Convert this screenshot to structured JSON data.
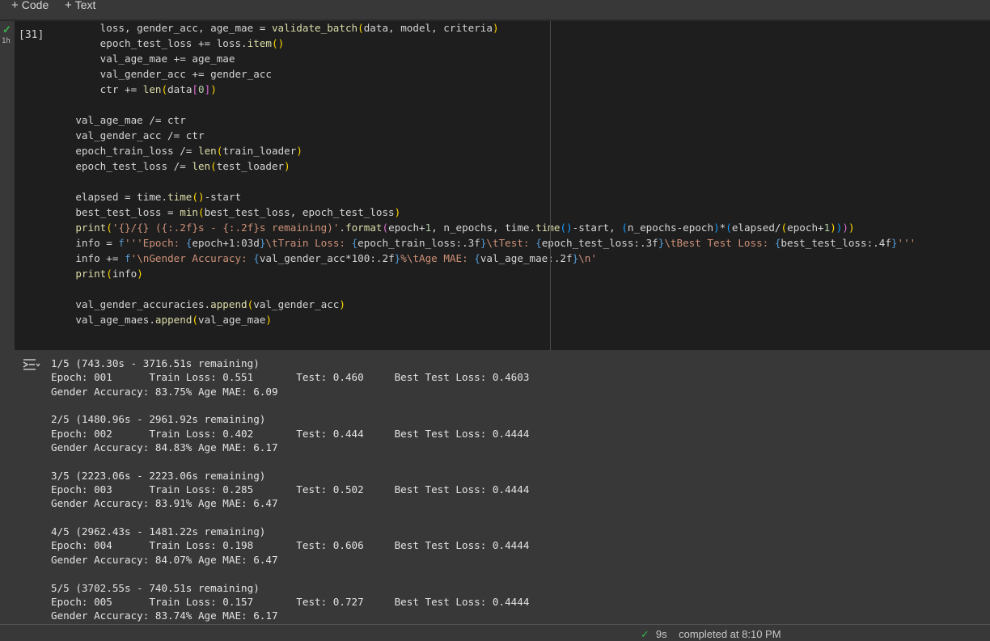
{
  "toolbar": {
    "code_label": "Code",
    "text_label": "Text"
  },
  "cell": {
    "exec_count": "[31]",
    "status_check": "✓",
    "exec_time": "1h"
  },
  "code_lines": [
    "        loss, gender_acc, age_mae = validate_batch(data, model, criteria)",
    "        epoch_test_loss += loss.item()",
    "        val_age_mae += age_mae",
    "        val_gender_acc += gender_acc",
    "        ctr += len(data[0])",
    "",
    "    val_age_mae /= ctr",
    "    val_gender_acc /= ctr",
    "    epoch_train_loss /= len(train_loader)",
    "    epoch_test_loss /= len(test_loader)",
    "",
    "    elapsed = time.time()-start",
    "    best_test_loss = min(best_test_loss, epoch_test_loss)",
    "    print('{}/{} ({:.2f}s - {:.2f}s remaining)'.format(epoch+1, n_epochs, time.time()-start, (n_epochs-epoch)*(elapsed/(epoch+1))))",
    "    info = f'''Epoch: {epoch+1:03d}\\tTrain Loss: {epoch_train_loss:.3f}\\tTest: {epoch_test_loss:.3f}\\tBest Test Loss: {best_test_loss:.4f}'''",
    "    info += f'\\nGender Accuracy: {val_gender_acc*100:.2f}%\\tAge MAE: {val_age_mae:.2f}\\n'",
    "    print(info)",
    "",
    "    val_gender_accuracies.append(val_gender_acc)",
    "    val_age_maes.append(val_age_mae)"
  ],
  "output_lines": [
    "1/5 (743.30s - 3716.51s remaining)",
    "Epoch: 001      Train Loss: 0.551       Test: 0.460     Best Test Loss: 0.4603",
    "Gender Accuracy: 83.75% Age MAE: 6.09",
    "",
    "2/5 (1480.96s - 2961.92s remaining)",
    "Epoch: 002      Train Loss: 0.402       Test: 0.444     Best Test Loss: 0.4444",
    "Gender Accuracy: 84.83% Age MAE: 6.17",
    "",
    "3/5 (2223.06s - 2223.06s remaining)",
    "Epoch: 003      Train Loss: 0.285       Test: 0.502     Best Test Loss: 0.4444",
    "Gender Accuracy: 83.91% Age MAE: 6.47",
    "",
    "4/5 (2962.43s - 1481.22s remaining)",
    "Epoch: 004      Train Loss: 0.198       Test: 0.606     Best Test Loss: 0.4444",
    "Gender Accuracy: 84.07% Age MAE: 6.47",
    "",
    "5/5 (3702.55s - 740.51s remaining)",
    "Epoch: 005      Train Loss: 0.157       Test: 0.727     Best Test Loss: 0.4444",
    "Gender Accuracy: 83.74% Age MAE: 6.17"
  ],
  "status": {
    "check": "✓",
    "duration": "9s",
    "completed": "completed at 8:10 PM"
  }
}
